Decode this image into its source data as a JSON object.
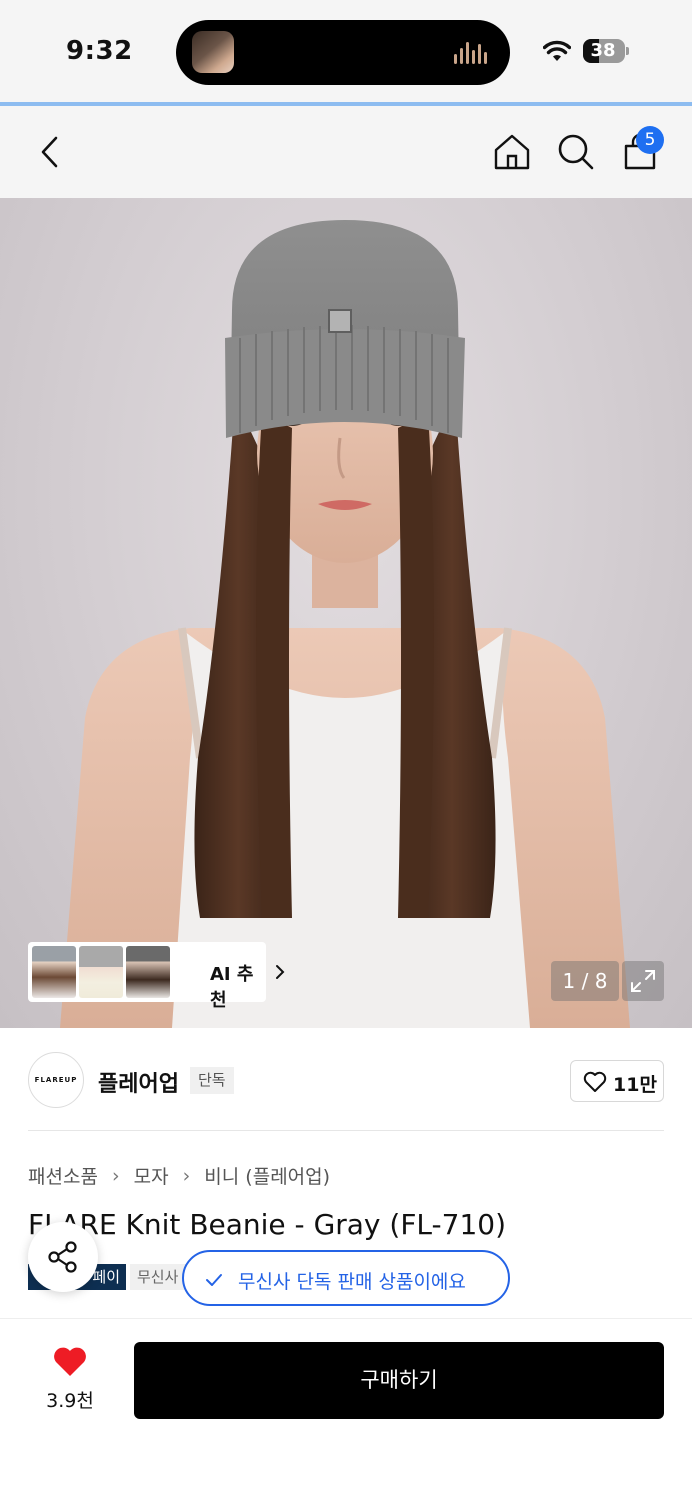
{
  "status_bar": {
    "time": "9:32",
    "battery_level": 38,
    "battery_label": "38"
  },
  "nav": {
    "cart_count": "5",
    "accent_color": "#1e6ff1"
  },
  "gallery": {
    "ai_recommend_label": "AI 추천",
    "counter": "1 / 8"
  },
  "brand": {
    "logo_text": "FLAREUP",
    "name": "플레어업",
    "exclusive_tag": "단독",
    "like_count": "11만"
  },
  "breadcrumb": [
    "패션소품",
    "모자",
    "비니 (플레어업)"
  ],
  "product": {
    "title": "FLARE Knit Beanie - Gray (FL-710)",
    "tag_dark": "페이",
    "tag_light": "무신사",
    "exclusive_toast": "무신사 단독 판매 상품이에요"
  },
  "bottom_bar": {
    "wish_count": "3.9천",
    "buy_label": "구매하기",
    "heart_color": "#ee1c25"
  }
}
